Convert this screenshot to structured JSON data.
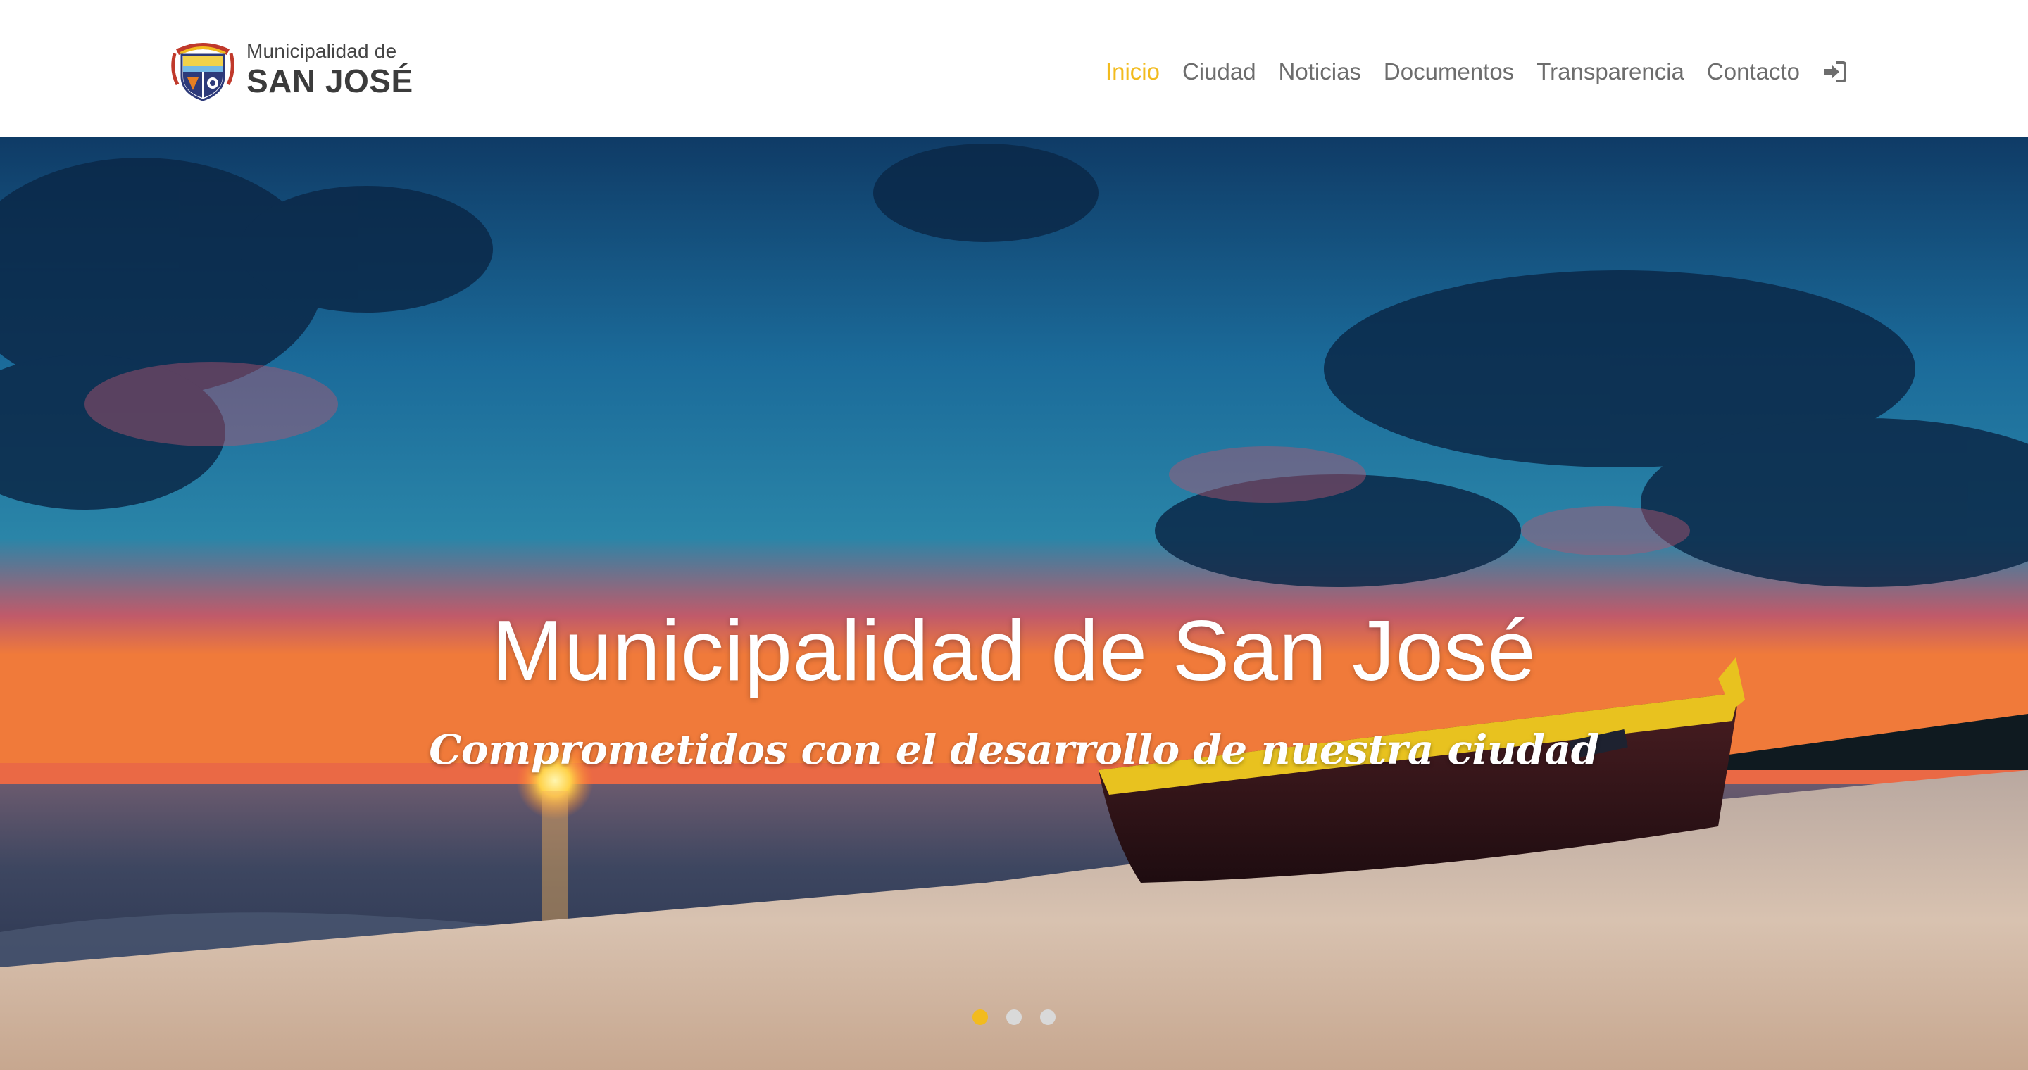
{
  "brand": {
    "line1": "Municipalidad de",
    "line2": "SAN JOSÉ",
    "logo_icon": "coat-of-arms-icon"
  },
  "nav": {
    "items": [
      {
        "label": "Inicio",
        "active": true
      },
      {
        "label": "Ciudad",
        "active": false
      },
      {
        "label": "Noticias",
        "active": false
      },
      {
        "label": "Documentos",
        "active": false
      },
      {
        "label": "Transparencia",
        "active": false
      },
      {
        "label": "Contacto",
        "active": false
      }
    ],
    "login_icon": "sign-in-icon"
  },
  "hero": {
    "title": "Municipalidad de San José",
    "subtitle": "Comprometidos con el desarrollo de nuestra ciudad",
    "background": "sunset-beach-boat",
    "slides_count": 3,
    "active_slide": 1
  },
  "colors": {
    "accent": "#f2bb1e",
    "nav_text": "#6d6d6d",
    "brand_text": "#3b3b3b",
    "header_bg": "#ffffff"
  }
}
